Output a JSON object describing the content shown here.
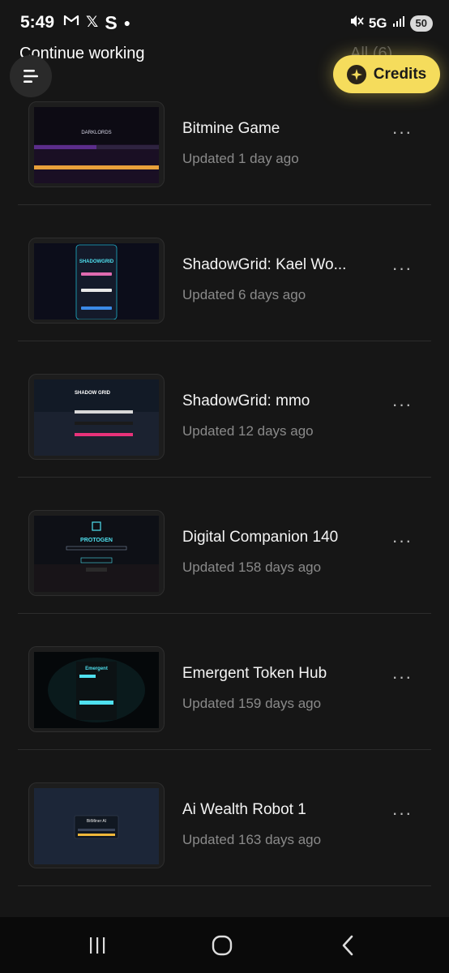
{
  "status_bar": {
    "time": "5:49",
    "left_icons": [
      "gmail-icon",
      "x-icon",
      "s-icon",
      "dot-icon"
    ],
    "network": "5G",
    "battery": "50"
  },
  "header": {
    "title": "Continue working",
    "filter_label": "All (6)"
  },
  "credits": {
    "label": "Credits",
    "color": "#f5dc5c"
  },
  "projects": [
    {
      "title": "Bitmine Game",
      "updated": "Updated 1 day ago",
      "thumb_text": "DARKLORDS"
    },
    {
      "title": "ShadowGrid: Kael Wo...",
      "updated": "Updated 6 days ago",
      "thumb_text": "SHADOWGRID"
    },
    {
      "title": "ShadowGrid: mmo",
      "updated": "Updated 12 days ago",
      "thumb_text": "SHADOW GRID"
    },
    {
      "title": "Digital Companion 140",
      "updated": "Updated 158 days ago",
      "thumb_text": "PROTOGEN"
    },
    {
      "title": "Emergent Token Hub",
      "updated": "Updated 159 days ago",
      "thumb_text": "Emergent"
    },
    {
      "title": "Ai Wealth Robot 1",
      "updated": "Updated 163 days ago",
      "thumb_text": "BitMiner AI"
    }
  ],
  "nav": [
    "recents-icon",
    "home-icon",
    "back-icon"
  ]
}
